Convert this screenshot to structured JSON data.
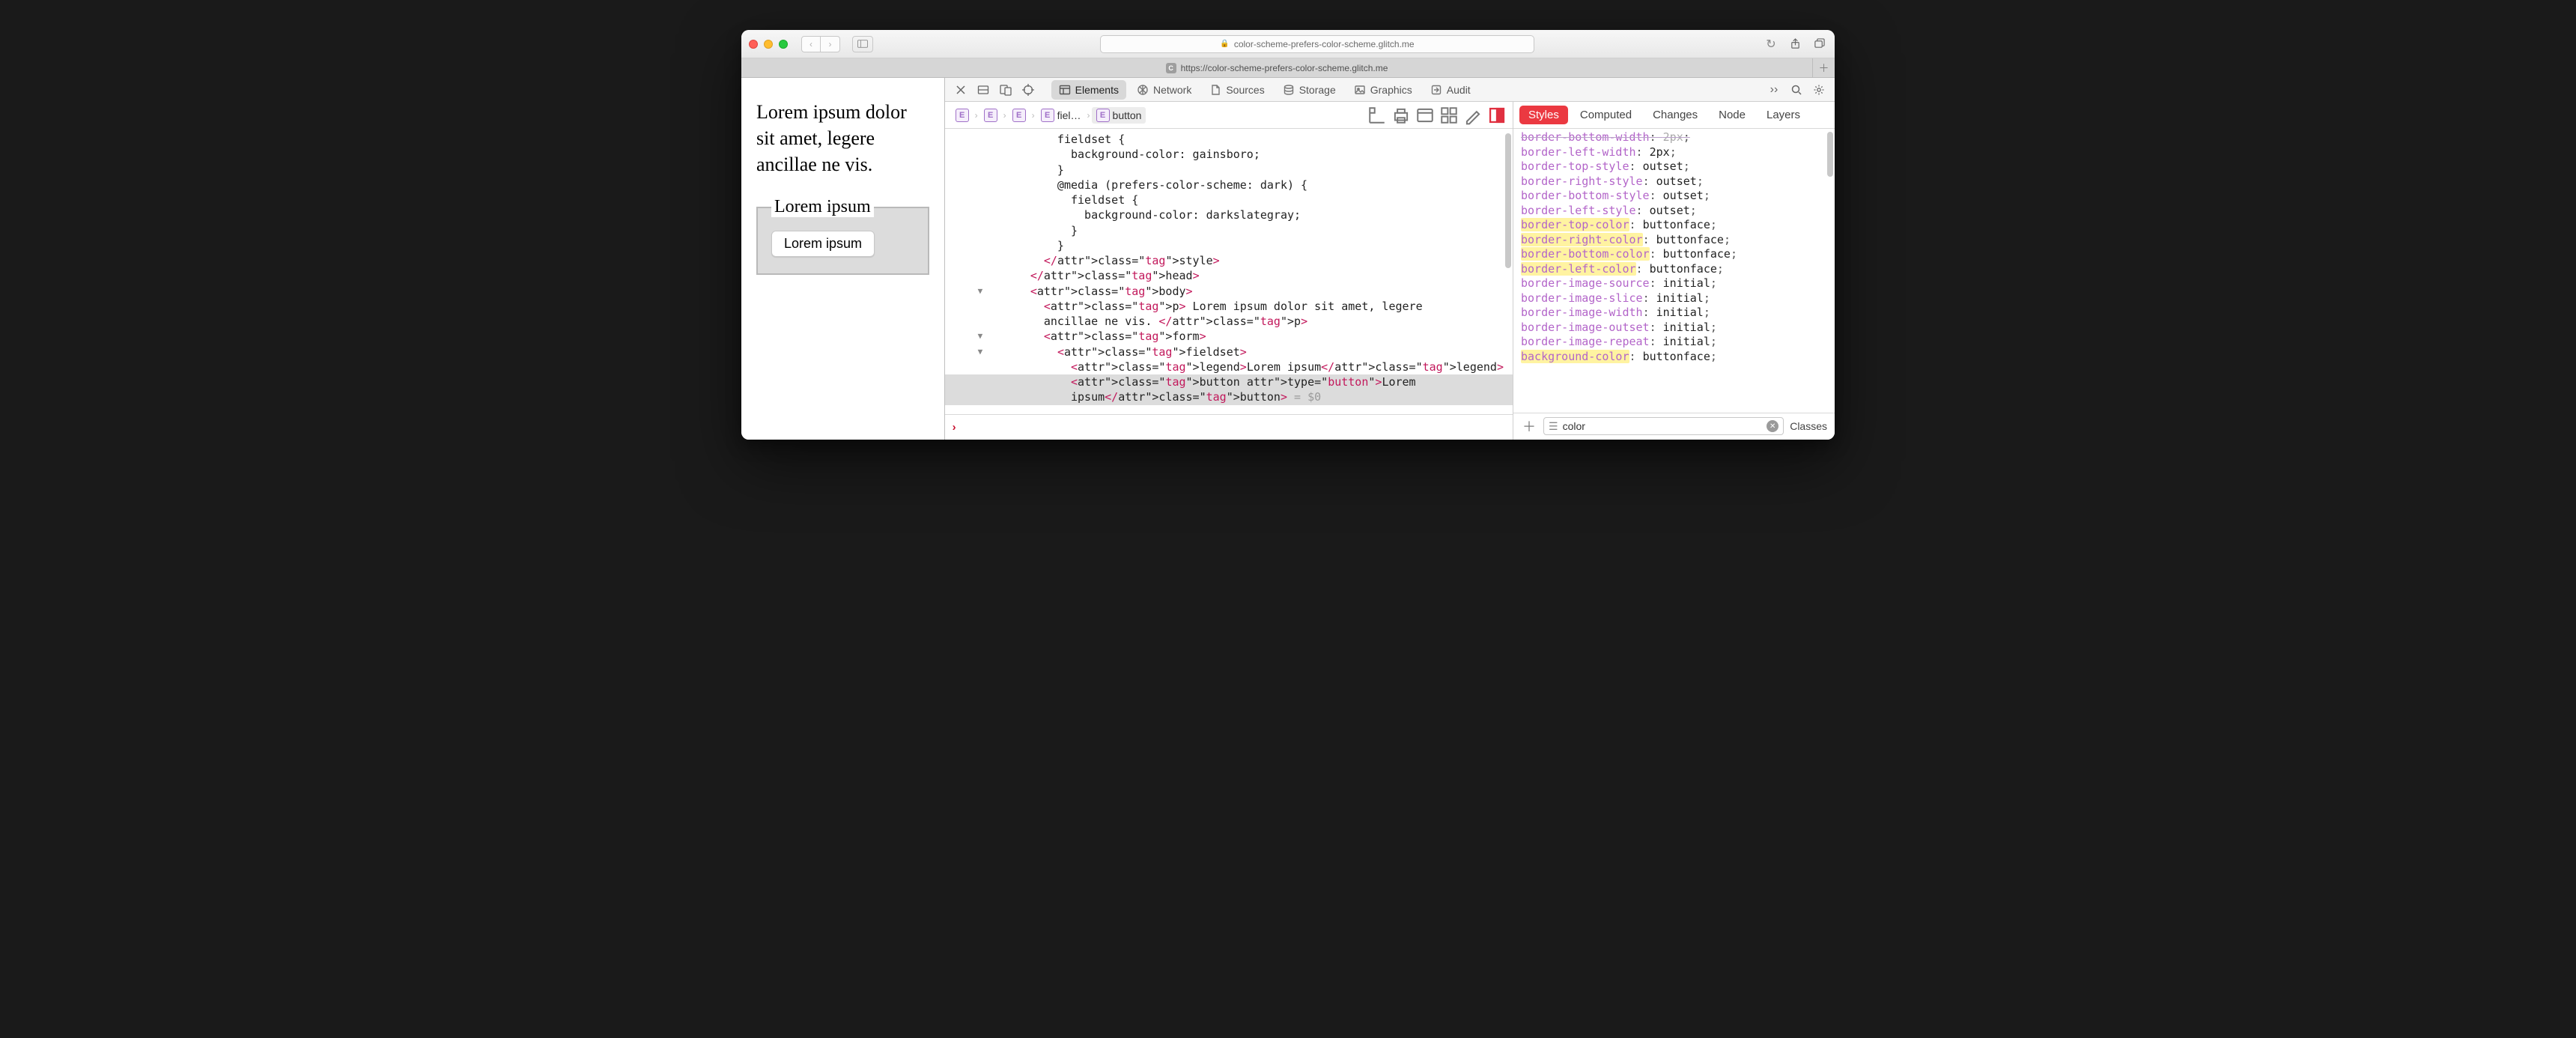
{
  "titlebar": {
    "url_display": "color-scheme-prefers-color-scheme.glitch.me"
  },
  "tab": {
    "favicon_letter": "C",
    "title": "https://color-scheme-prefers-color-scheme.glitch.me"
  },
  "page": {
    "paragraph": "Lorem ipsum dolor sit amet, legere ancillae ne vis.",
    "legend": "Lorem ipsum",
    "button": "Lorem ipsum"
  },
  "devtools": {
    "tabs": {
      "elements": "Elements",
      "network": "Network",
      "sources": "Sources",
      "storage": "Storage",
      "graphics": "Graphics",
      "audit": "Audit"
    },
    "crumbs": {
      "fieldset": "fiel…",
      "button": "button"
    },
    "dom_lines": [
      "          fieldset {",
      "            background-color: gainsboro;",
      "          }",
      "          @media (prefers-color-scheme: dark) {",
      "            fieldset {",
      "              background-color: darkslategray;",
      "            }",
      "          }",
      "        </style>",
      "      </head>",
      "      <body>",
      "        <p> Lorem ipsum dolor sit amet, legere",
      "        ancillae ne vis. </p>",
      "        <form>",
      "          <fieldset>",
      "            <legend>Lorem ipsum</legend>",
      "            <button type=\"button\">Lorem",
      "            ipsum</button> = $0"
    ],
    "styles_tabs": {
      "styles": "Styles",
      "computed": "Computed",
      "changes": "Changes",
      "node": "Node",
      "layers": "Layers"
    },
    "style_rows": [
      {
        "prop": "border-bottom-width",
        "val": "2px",
        "hl": false,
        "strike": true
      },
      {
        "prop": "border-left-width",
        "val": "2px",
        "hl": false,
        "strike": false
      },
      {
        "prop": "border-top-style",
        "val": "outset",
        "hl": false,
        "strike": false
      },
      {
        "prop": "border-right-style",
        "val": "outset",
        "hl": false,
        "strike": false
      },
      {
        "prop": "border-bottom-style",
        "val": "outset",
        "hl": false,
        "strike": false
      },
      {
        "prop": "border-left-style",
        "val": "outset",
        "hl": false,
        "strike": false
      },
      {
        "prop": "border-top-color",
        "val": "buttonface",
        "hl": true,
        "strike": false
      },
      {
        "prop": "border-right-color",
        "val": "buttonface",
        "hl": true,
        "strike": false
      },
      {
        "prop": "border-bottom-color",
        "val": "buttonface",
        "hl": true,
        "strike": false
      },
      {
        "prop": "border-left-color",
        "val": "buttonface",
        "hl": true,
        "strike": false
      },
      {
        "prop": "border-image-source",
        "val": "initial",
        "hl": false,
        "strike": false
      },
      {
        "prop": "border-image-slice",
        "val": "initial",
        "hl": false,
        "strike": false
      },
      {
        "prop": "border-image-width",
        "val": "initial",
        "hl": false,
        "strike": false
      },
      {
        "prop": "border-image-outset",
        "val": "initial",
        "hl": false,
        "strike": false
      },
      {
        "prop": "border-image-repeat",
        "val": "initial",
        "hl": false,
        "strike": false
      },
      {
        "prop": "background-color",
        "val": "buttonface",
        "hl": true,
        "strike": false
      }
    ],
    "filter_value": "color",
    "classes_label": "Classes"
  }
}
